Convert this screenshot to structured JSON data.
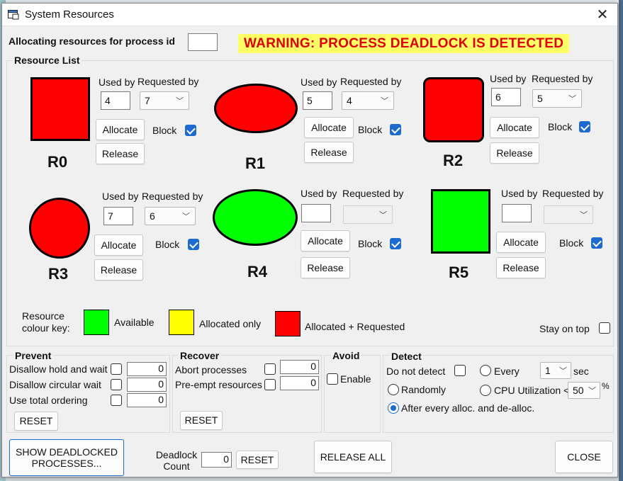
{
  "window": {
    "title": "System Resources"
  },
  "colors": {
    "available": "#00ff00",
    "allocated_only": "#ffff00",
    "allocated_requested": "#ff0000",
    "warning_bg": "#ffff66",
    "warning_text": "#e00000"
  },
  "header": {
    "process_label": "Allocating resources for process id",
    "process_id_value": "",
    "warning": "WARNING: PROCESS DEADLOCK IS DETECTED"
  },
  "resource_list": {
    "title": "Resource List",
    "used_by_label": "Used by",
    "requested_by_label": "Requested by",
    "allocate_label": "Allocate",
    "release_label": "Release",
    "block_label": "Block",
    "resources": [
      {
        "name": "R0",
        "shape": "square",
        "color": "#ff0000",
        "used_by": "4",
        "requested_by": "7",
        "block": true
      },
      {
        "name": "R1",
        "shape": "ellipse",
        "color": "#ff0000",
        "used_by": "5",
        "requested_by": "4",
        "block": true
      },
      {
        "name": "R2",
        "shape": "rounded-square",
        "color": "#ff0000",
        "used_by": "6",
        "requested_by": "5",
        "block": true
      },
      {
        "name": "R3",
        "shape": "circle",
        "color": "#ff0000",
        "used_by": "7",
        "requested_by": "6",
        "block": true
      },
      {
        "name": "R4",
        "shape": "ellipse",
        "color": "#00ff00",
        "used_by": "",
        "requested_by": "",
        "block": true
      },
      {
        "name": "R5",
        "shape": "square",
        "color": "#00ff00",
        "used_by": "",
        "requested_by": "",
        "block": true
      }
    ]
  },
  "colour_key": {
    "label": "Resource colour key:",
    "available": "Available",
    "allocated_only": "Allocated only",
    "allocated_requested": "Allocated + Requested"
  },
  "stay_on_top": {
    "label": "Stay on top",
    "checked": false
  },
  "prevent": {
    "title": "Prevent",
    "items": [
      {
        "label": "Disallow hold and wait",
        "value": "0"
      },
      {
        "label": "Disallow circular wait",
        "value": "0"
      },
      {
        "label": "Use total ordering",
        "value": "0"
      }
    ],
    "reset_label": "RESET"
  },
  "recover": {
    "title": "Recover",
    "items": [
      {
        "label": "Abort processes",
        "value": "0"
      },
      {
        "label": "Pre-empt resources",
        "value": "0"
      }
    ],
    "reset_label": "RESET"
  },
  "avoid": {
    "title": "Avoid",
    "enable_label": "Enable"
  },
  "detect": {
    "title": "Detect",
    "do_not_detect": "Do not detect",
    "every": "Every",
    "every_value": "1",
    "sec": "sec",
    "randomly": "Randomly",
    "cpu": "CPU Utilization <",
    "cpu_value": "50",
    "percent": "%",
    "after_every": "After every alloc. and de-alloc."
  },
  "footer": {
    "show_deadlocked": "SHOW DEADLOCKED PROCESSES...",
    "deadlock_count_label": "Deadlock Count",
    "deadlock_count_value": "0",
    "reset": "RESET",
    "release_all": "RELEASE ALL",
    "close": "CLOSE"
  }
}
